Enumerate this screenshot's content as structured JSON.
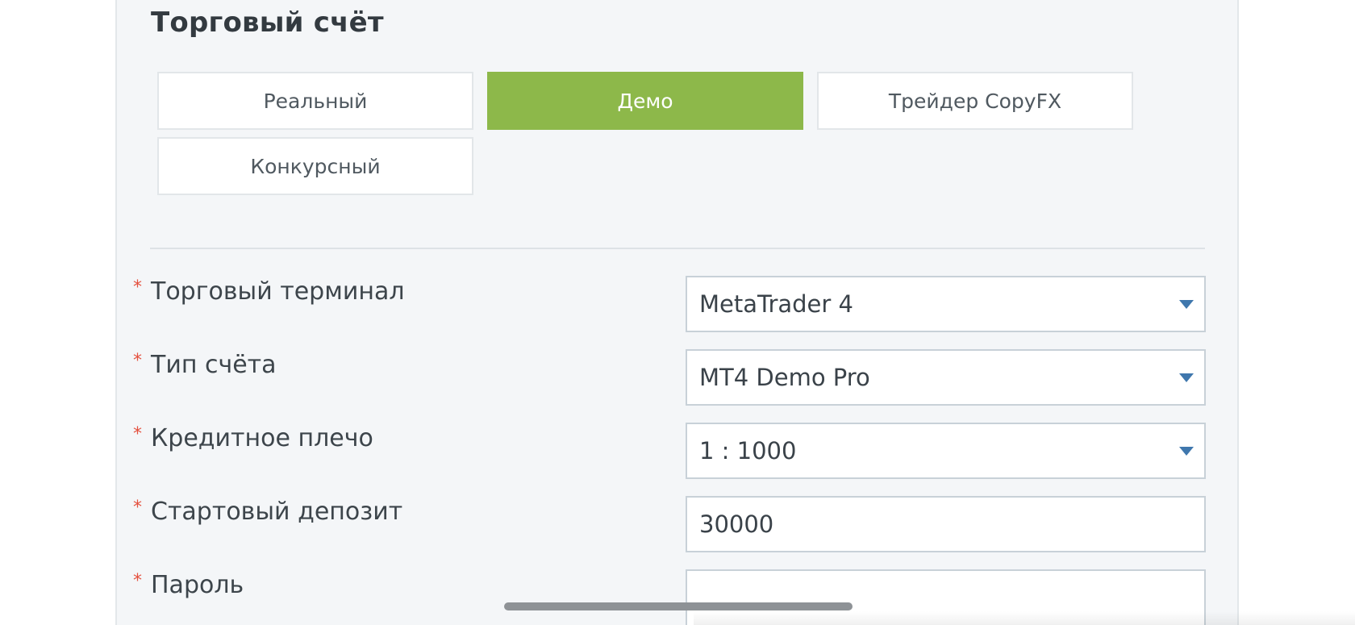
{
  "section": {
    "title": "Торговый счёт"
  },
  "account_types": [
    {
      "label": "Реальный",
      "active": false
    },
    {
      "label": "Демо",
      "active": true
    },
    {
      "label": "Трейдер CopyFX",
      "active": false
    },
    {
      "label": "Конкурсный",
      "active": false
    }
  ],
  "form": {
    "required_mark": "*",
    "terminal": {
      "label": "Торговый терминал",
      "value": "MetaTrader 4"
    },
    "account_type": {
      "label": "Тип счёта",
      "value": "MT4 Demo Pro"
    },
    "leverage": {
      "label": "Кредитное плечо",
      "value": "1 : 1000"
    },
    "deposit": {
      "label": "Стартовый депозит",
      "value": "30000"
    },
    "password": {
      "label": "Пароль",
      "value": ""
    }
  },
  "colors": {
    "active_button": "#8db84a",
    "required_asterisk": "#e4513f",
    "dropdown_caret": "#3f77ad",
    "panel_background": "#f4f6f8"
  },
  "icons": {
    "dropdown": "caret-down-icon"
  }
}
